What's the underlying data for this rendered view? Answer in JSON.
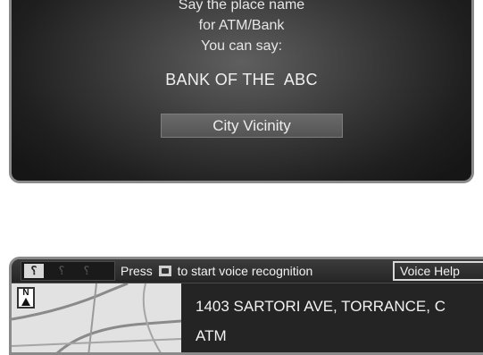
{
  "voice_prompt": {
    "line1": "Say the place name",
    "line2": "for ATM/Bank",
    "line3": "You can say:",
    "example": "BANK OF THE  ABC",
    "option_button": "City Vicinity"
  },
  "status_bar": {
    "mode_icons": [
      "voice-active-icon",
      "voice-dim-icon",
      "voice-dim-icon"
    ],
    "instruction_prefix": "Press",
    "instruction_suffix": "to start voice recognition",
    "talk_icon": "talk-button-icon",
    "help_button": "Voice Help"
  },
  "map": {
    "compass_label": "N"
  },
  "destination": {
    "address": "1403 SARTORI AVE, TORRANCE, C",
    "category": "ATM"
  },
  "colors": {
    "panel_background": "#2a2a2a",
    "panel_border": "#8a8a8a",
    "text": "#e6e6e6",
    "button": "#5e5e5e"
  }
}
